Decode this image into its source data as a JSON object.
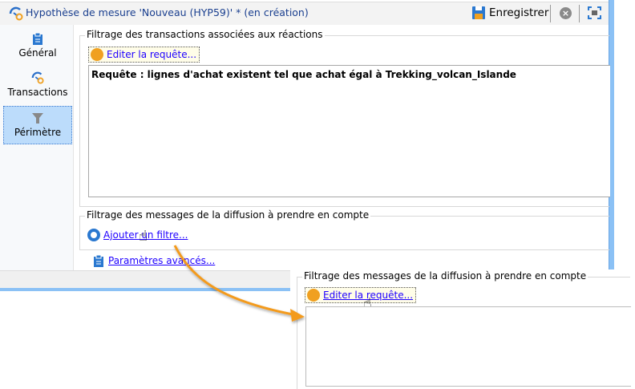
{
  "window": {
    "title": "Hypothèse de mesure 'Nouveau (HYP59)' * (en création)",
    "save_label": "Enregistrer",
    "icons": [
      "hypothesis-icon",
      "save-icon",
      "close-icon",
      "maximize-icon"
    ]
  },
  "sidebar": {
    "items": [
      {
        "label": "Général",
        "icon": "clipboard-icon"
      },
      {
        "label": "Transactions",
        "icon": "hypothesis-icon"
      },
      {
        "label": "Périmètre",
        "icon": "funnel-icon",
        "selected": true
      }
    ]
  },
  "main": {
    "group1": {
      "title": "Filtrage des transactions associées aux réactions",
      "edit_link": "Editer la requête...",
      "query_text": "Requête : lignes d'achat existent tel que achat égal à Trekking_volcan_Islande"
    },
    "group2": {
      "title": "Filtrage des messages de la diffusion à prendre en compte",
      "add_filter_link": "Ajouter un filtre..."
    },
    "advanced_link": "Paramètres avancés..."
  },
  "overlay": {
    "group_title": "Filtrage des messages de la diffusion à prendre en compte",
    "edit_link": "Editer la requête..."
  },
  "colors": {
    "accent": "#1f00ff",
    "orange": "#f0a020",
    "selection": "#bcdcfb",
    "window_border": "#8bc1f5"
  }
}
